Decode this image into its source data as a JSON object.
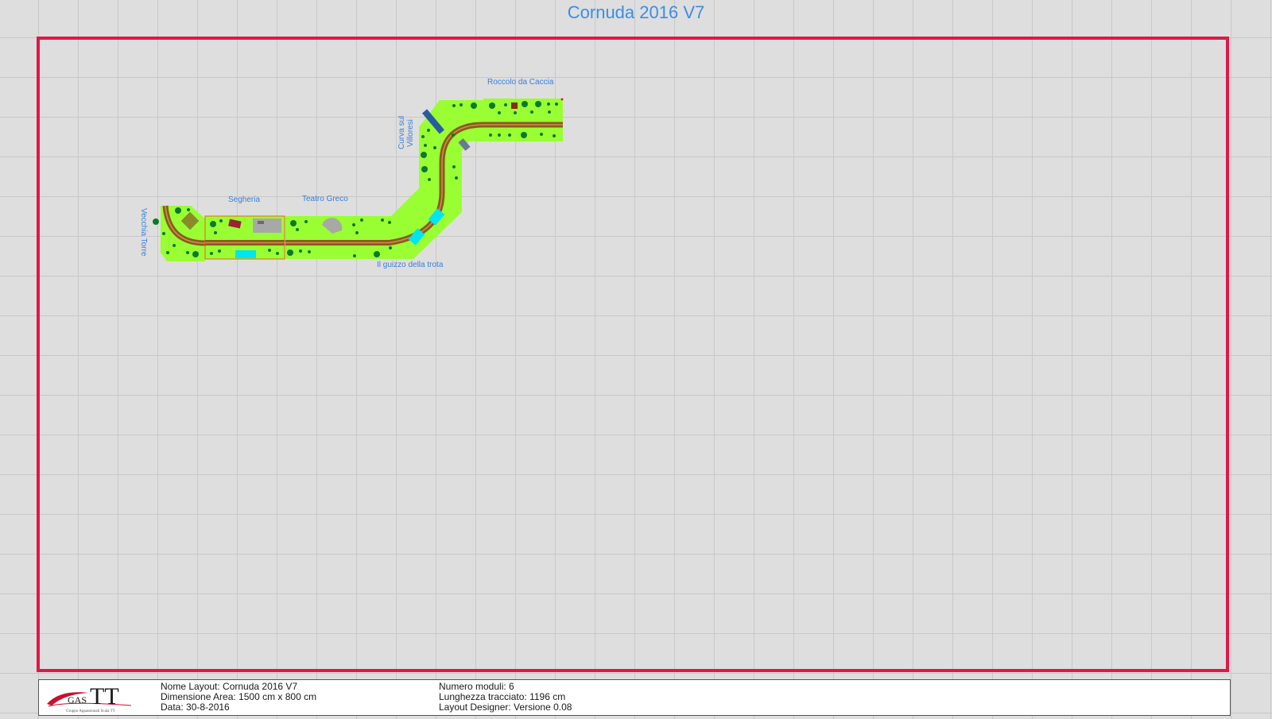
{
  "title": "Cornuda 2016 V7",
  "colors": {
    "accent_text": "#3a8ee6",
    "area_border": "#e01848",
    "grass": "#99ff33",
    "track": "#8b5a1e",
    "tree": "#0a7a2a",
    "water": "#00e5ee"
  },
  "modules": {
    "vecchia_torre": "Vecchia Torre",
    "segheria": "Segheria",
    "teatro_greco": "Teatro Greco",
    "guizzo_trota": "Il guizzo della trota",
    "curva_villoresi_line1": "Curva sul",
    "curva_villoresi_line2": "Villoresi",
    "roccolo_caccia": "Roccolo da Caccia"
  },
  "info": {
    "nome_layout": "Nome Layout: Cornuda 2016 V7",
    "dimensione_area": "Dimensione Area: 1500 cm x 800 cm",
    "data": "Data: 30-8-2016",
    "numero_moduli": "Numero moduli: 6",
    "lunghezza_tracciato": "Lunghezza tracciato: 1196 cm",
    "designer": "Layout Designer: Versione 0.08"
  },
  "logo": {
    "text_gas": "GAS",
    "text_tt": "TT",
    "subtitle": "Gruppo Appassionati Scala TT"
  }
}
